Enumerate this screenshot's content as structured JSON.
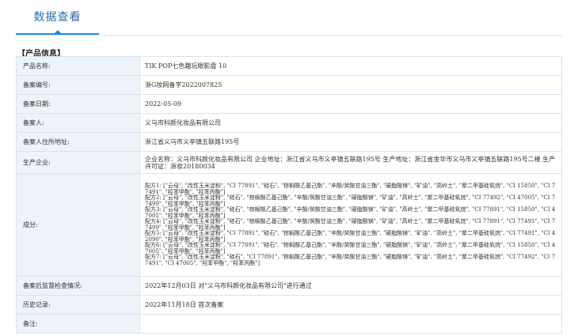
{
  "tabs": [
    {
      "label": "数据查看"
    }
  ],
  "section": {
    "title": "【产品信息】"
  },
  "rows": [
    {
      "label": "产品名称:",
      "value": "TIK POP七色趣玩眼影盘 10"
    },
    {
      "label": "备案编号:",
      "value": "浙G妆网备字2022007825"
    },
    {
      "label": "备案日期:",
      "value": "2022-05-09"
    },
    {
      "label": "备案人:",
      "value": "义乌市科颜化妆品有限公司"
    },
    {
      "label": "备案人住所地址:",
      "value": "浙江省义乌市义亭镇五联路195号"
    },
    {
      "label": "生产企业:",
      "value": "企业名称：义乌市科颜化妆品有限公司 企业地址：浙江省义乌市义亭镇五联路195号 生产地址：浙江省金华市义乌市义亭镇五联路195号二楼 生产许可证：浙妆20180034"
    }
  ],
  "ingredients": {
    "label": "成分:",
    "formulas": [
      "配方1: [\"云母\", \"改性玉米淀粉\", \"CI 77891\", \"硅石\", \"棕榈酸乙基己酯\", \"辛酸/癸酸甘油三酯\", \"硬脂酸镁\", \"矿油\", \"高岭土\", \"聚二甲基硅氧烷\", \"CI 15850\", \"CI 77491\", \"羟苯甲酯\", \"羟苯丙酯\"]",
      "配方2: [\"云母\", \"改性玉米淀粉\", \"硅石\", \"棕榈酸乙基己酯\", \"辛酸/癸酸甘油三酯\", \"硬脂酸镁\", \"矿油\", \"高岭土\", \"聚二甲基硅氧烷\", \"CI 77492\", \"CI 47005\", \"CI 77499\", \"羟苯甲酯\", \"羟苯丙酯\"]",
      "配方3: [\"云母\", \"改性玉米淀粉\", \"硅石\", \"棕榈酸乙基己酯\", \"辛酸/癸酸甘油三酯\", \"硬脂酸镁\", \"矿油\", \"高岭土\", \"聚二甲基硅氧烷\", \"CI 77891\", \"CI 15850\", \"CI 47005\", \"羟苯甲酯\", \"羟苯丙酯\"]",
      "配方4: [\"云母\", \"改性玉米淀粉\", \"硅石\", \"棕榈酸乙基己酯\", \"辛酸/癸酸甘油三酯\", \"硬脂酸镁\", \"矿油\", \"高岭土\", \"聚二甲基硅氧烷\", \"CI 77891\", \"CI 77491\", \"CI 77499\", \"羟苯甲酯\", \"羟苯丙酯\"]",
      "配方5: [\"云母\", \"改性玉米淀粉\", \"CI 77891\", \"硅石\", \"棕榈酸乙基己酯\", \"辛酸/癸酸甘油三酯\", \"硬脂酸镁\", \"矿油\", \"高岭土\", \"聚二甲基硅氧烷\", \"CI 77491\", \"CI 42090\", \"羟苯甲酯\", \"羟苯丙酯\"]",
      "配方6: [\"云母\", \"改性玉米淀粉\", \"CI 77891\", \"硅石\", \"棕榈酸乙基己酯\", \"辛酸/癸酸甘油三酯\", \"硬脂酸镁\", \"矿油\", \"高岭土\", \"聚二甲基硅氧烷\", \"CI 15850\", \"CI 47005\", \"羟苯甲酯\", \"羟苯丙酯\"]",
      "配方7: [\"云母\", \"改性玉米淀粉\", \"硅石\", \"CI 77891\", \"棕榈酸乙基己酯\", \"辛酸/癸酸甘油三酯\", \"硬脂酸镁\", \"矿油\", \"高岭土\", \"聚二甲基硅氧烷\", \"CI 77492\", \"CI 77491\", \"CI 47005\", \"羟苯甲酯\", \"羟苯丙酯\"]"
    ]
  },
  "rows_after": [
    {
      "label": "备案后监督检查情况:",
      "value": "2022年12月03日 对\"义乌市科颜化妆品有限公司\"进行通过"
    },
    {
      "label": "历史记录:",
      "value": "2022年11月18日 首次备案"
    },
    {
      "label": "备注:",
      "value": ""
    }
  ]
}
